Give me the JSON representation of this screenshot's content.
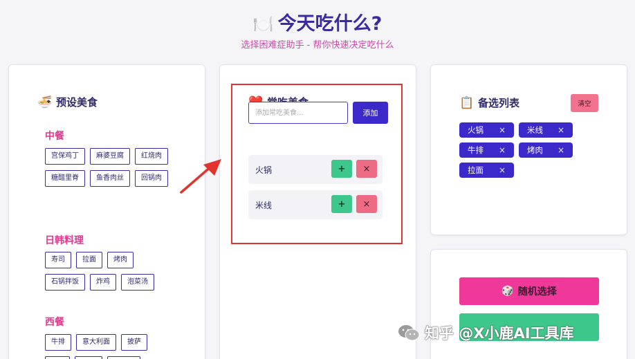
{
  "header": {
    "title": "今天吃什么?",
    "title_icon": "🍽️",
    "subtitle": "选择困难症助手 - 帮你快速决定吃什么"
  },
  "preset": {
    "title": "预设美食",
    "icon": "🍜",
    "categories": [
      {
        "name": "中餐",
        "items": [
          "宫保鸡丁",
          "麻婆豆腐",
          "红烧肉",
          "糖醋里脊",
          "鱼香肉丝",
          "回锅肉"
        ]
      },
      {
        "name": "日韩料理",
        "items": [
          "寿司",
          "拉面",
          "烤肉",
          "石锅拌饭",
          "炸鸡",
          "泡菜汤"
        ]
      },
      {
        "name": "西餐",
        "items": [
          "牛排",
          "意大利面",
          "披萨"
        ]
      }
    ]
  },
  "favorites": {
    "title": "常吃美食",
    "icon": "❤️",
    "input_placeholder": "添加常吃美食...",
    "add_label": "添加",
    "items": [
      {
        "name": "火锅",
        "plus": "+",
        "remove": "×"
      },
      {
        "name": "米线",
        "plus": "+",
        "remove": "×"
      }
    ]
  },
  "candidates": {
    "title": "备选列表",
    "icon": "📋",
    "clear_label": "清空",
    "items": [
      "火锅",
      "米线",
      "牛排",
      "烤肉",
      "拉面"
    ],
    "remove_glyph": "×"
  },
  "actions": {
    "random_label": "随机选择",
    "random_icon": "🎲"
  },
  "watermark": {
    "text": "知乎 @X小鹿AI工具库"
  },
  "colors": {
    "primary": "#3b2ac9",
    "accent_pink": "#f0389a",
    "success": "#3ec78a",
    "danger": "#ee6b86",
    "highlight": "#e2342e"
  }
}
